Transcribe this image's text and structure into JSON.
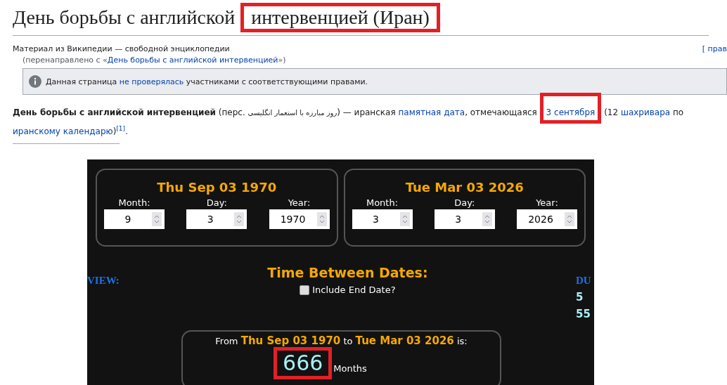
{
  "title": [
    {
      "text": "День борьбы с английской",
      "annotated": false
    },
    {
      "text": "интервенцией (Иран)",
      "annotated": true
    }
  ],
  "tagline": "Материал из Википедии — свободной энциклопедии",
  "edit_link": "[ прав",
  "redirect": {
    "before": "(перенаправлено с «",
    "link": "День борьбы с английской интервенцией",
    "after": "»)"
  },
  "notice": {
    "before": "Данная страница",
    "link": "не проверялась",
    "after": "участниками с соответствующими правами."
  },
  "lead": [
    {
      "kind": "bold",
      "text": "День борьбы с английской интервенцией"
    },
    {
      "kind": "text",
      "text": " (перс. "
    },
    {
      "kind": "rtl",
      "text": "روز مبارزه با استعمار انگلیسی"
    },
    {
      "kind": "text",
      "text": ") — иранская "
    },
    {
      "kind": "link",
      "text": "памятная дата",
      "annotated": false
    },
    {
      "kind": "text",
      "text": ", отмечающаяся "
    },
    {
      "kind": "link",
      "text": "3 сентября",
      "annotated": true
    },
    {
      "kind": "text",
      "text": " (12 "
    },
    {
      "kind": "link",
      "text": "шахривара",
      "annotated": false
    },
    {
      "kind": "text",
      "text": " по "
    },
    {
      "kind": "link",
      "text": "иранскому календарю",
      "annotated": false
    },
    {
      "kind": "text",
      "text": ")"
    },
    {
      "kind": "ref",
      "text": "[1]"
    },
    {
      "kind": "text",
      "text": "."
    }
  ],
  "calculator": {
    "dates": [
      {
        "heading": "Thu Sep 03 1970",
        "fields": [
          {
            "label": "Month:",
            "value": "9"
          },
          {
            "label": "Day:",
            "value": "3"
          },
          {
            "label": "Year:",
            "value": "1970"
          }
        ]
      },
      {
        "heading": "Tue Mar 03 2026",
        "fields": [
          {
            "label": "Month:",
            "value": "3"
          },
          {
            "label": "Day:",
            "value": "3"
          },
          {
            "label": "Year:",
            "value": "2026"
          }
        ]
      }
    ],
    "side_left": "VIEW:",
    "side_right": "DU",
    "side_numbers": [
      "5",
      "55"
    ],
    "section_title": "Time Between Dates:",
    "include_end_date": {
      "label": "Include End Date?",
      "checked": false
    },
    "result": {
      "from": "From",
      "start": "Thu Sep 03 1970",
      "to": "to",
      "end": "Tue Mar 03 2026",
      "is": "is:",
      "value": "666",
      "unit": "Months",
      "annotated": true
    }
  }
}
